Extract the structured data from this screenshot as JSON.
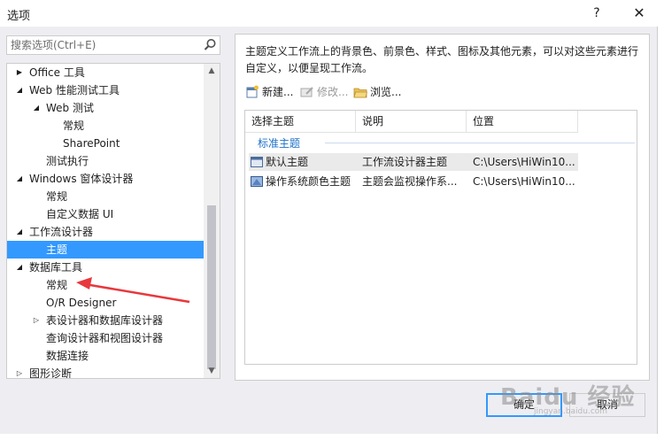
{
  "window": {
    "title": "选项",
    "help_glyph": "?",
    "close_glyph": "✕"
  },
  "search": {
    "placeholder": "搜索选项(Ctrl+E)"
  },
  "tree": {
    "items": [
      {
        "label": "Office 工具",
        "arrow": "▶"
      },
      {
        "label": "Web 性能测试工具",
        "arrow": "◢"
      },
      {
        "label": "Web 测试",
        "arrow": "◢"
      },
      {
        "label": "常规",
        "arrow": ""
      },
      {
        "label": "SharePoint",
        "arrow": ""
      },
      {
        "label": "测试执行",
        "arrow": ""
      },
      {
        "label": "Windows 窗体设计器",
        "arrow": "◢"
      },
      {
        "label": "常规",
        "arrow": ""
      },
      {
        "label": "自定义数据 UI",
        "arrow": ""
      },
      {
        "label": "工作流设计器",
        "arrow": "◢"
      },
      {
        "label": "主题",
        "arrow": "",
        "selected": true
      },
      {
        "label": "数据库工具",
        "arrow": "◢"
      },
      {
        "label": "常规",
        "arrow": ""
      },
      {
        "label": "O/R Designer",
        "arrow": ""
      },
      {
        "label": "表设计器和数据库设计器",
        "arrow": "▷"
      },
      {
        "label": "查询设计器和视图设计器",
        "arrow": ""
      },
      {
        "label": "数据连接",
        "arrow": ""
      },
      {
        "label": "图形诊断",
        "arrow": "▷"
      }
    ],
    "scroll_up": "▲",
    "scroll_down": "▼"
  },
  "panel": {
    "description": "主题定义工作流上的背景色、前景色、样式、图标及其他元素，可以对这些元素进行自定义，以便呈现工作流。",
    "toolbar": {
      "new_label": "新建...",
      "edit_label": "修改...",
      "browse_label": "浏览..."
    },
    "list": {
      "headers": [
        "选择主题",
        "说明",
        "位置"
      ],
      "group": "标准主题",
      "rows": [
        {
          "name": "默认主题",
          "desc": "工作流设计器主题",
          "location": "C:\\Users\\HiWin10..."
        },
        {
          "name": "操作系统颜色主题",
          "desc": "主题会监视操作系...",
          "location": "C:\\Users\\HiWin10..."
        }
      ]
    }
  },
  "buttons": {
    "ok_label": "确定",
    "cancel_label": "取消"
  },
  "watermark": {
    "text": "Baidu 经验",
    "sub": "jingyan.baidu.com"
  },
  "colors": {
    "selection": "#3399ff",
    "annotation_arrow": "#e8383d",
    "group_label": "#1e70c8"
  }
}
